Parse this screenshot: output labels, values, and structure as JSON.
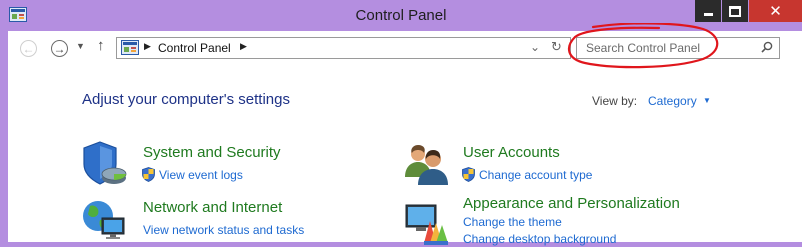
{
  "window": {
    "title": "Control Panel",
    "controls": [
      "minimize",
      "maximize",
      "close"
    ]
  },
  "navigation": {
    "address_crumbs": [
      "Control Panel"
    ],
    "search_placeholder": "Search Control Panel",
    "search_value": ""
  },
  "main": {
    "heading": "Adjust your computer's settings",
    "view_by_label": "View by:",
    "view_by_value": "Category"
  },
  "categories": [
    {
      "title": "System and Security",
      "icon": "system-security-icon",
      "links": [
        {
          "label": "View event logs",
          "shield": true
        }
      ]
    },
    {
      "title": "Network and Internet",
      "icon": "network-internet-icon",
      "links": [
        {
          "label": "View network status and tasks",
          "shield": false
        }
      ]
    },
    {
      "title": "User Accounts",
      "icon": "user-accounts-icon",
      "links": [
        {
          "label": "Change account type",
          "shield": true
        }
      ]
    },
    {
      "title": "Appearance and Personalization",
      "icon": "appearance-personalization-icon",
      "links": [
        {
          "label": "Change the theme",
          "shield": false
        },
        {
          "label": "Change desktop background",
          "shield": false
        }
      ]
    }
  ],
  "colors": {
    "window_frame": "#b48ee0",
    "category_title": "#1f7a1f",
    "link": "#1e6ad1",
    "heading": "#1e3287",
    "close_button": "#c7362f",
    "annotation": "#e0161c"
  }
}
